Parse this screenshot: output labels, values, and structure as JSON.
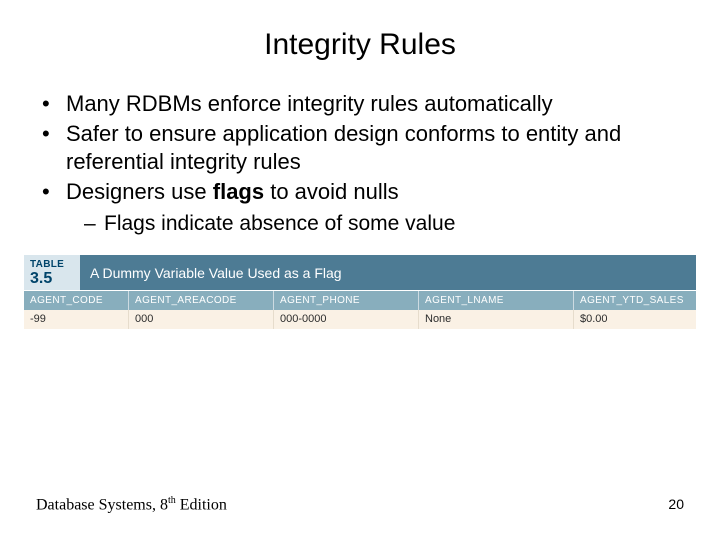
{
  "title": "Integrity Rules",
  "bullets": {
    "b1": "Many RDBMs enforce integrity rules automatically",
    "b2": "Safer to ensure application design conforms to entity and referential integrity rules",
    "b3_pre": "Designers use ",
    "b3_bold": "flags",
    "b3_post": " to avoid nulls",
    "sub1": "Flags indicate absence of some value"
  },
  "table": {
    "label_top": "TABLE",
    "label_num": "3.5",
    "caption": "A Dummy Variable Value Used as a Flag",
    "headers": [
      "AGENT_CODE",
      "AGENT_AREACODE",
      "AGENT_PHONE",
      "AGENT_LNAME",
      "AGENT_YTD_SALES"
    ],
    "row": [
      "-99",
      "000",
      "000-0000",
      "None",
      "$0.00"
    ]
  },
  "footer": {
    "book_pre": "Database Systems, 8",
    "book_sup": "th",
    "book_post": " Edition",
    "page": "20"
  }
}
